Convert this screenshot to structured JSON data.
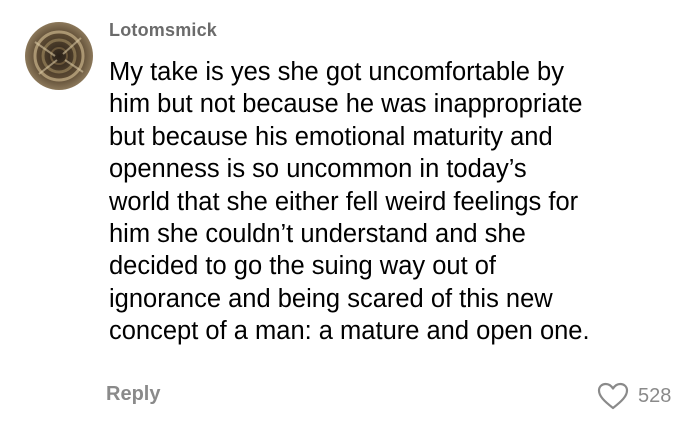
{
  "comment": {
    "username": "Lotomsmick",
    "avatar_icon": "avatar-photo-spiral-staircase",
    "lines": [
      "My take is yes she got uncomfortable by",
      "him but not because he was inappropriate",
      "but because his emotional maturity and",
      "openness is so uncommon in today’s",
      "world that she either fell weird feelings for",
      "him she couldn’t understand and she",
      "decided to go the suing way out of",
      "ignorance and being scared of this new",
      "concept of a man: a mature and open one."
    ],
    "reply_label": "Reply",
    "like_icon": "heart-outline-icon",
    "like_count": "528"
  },
  "colors": {
    "username": "#6b6b6b",
    "text": "#000000",
    "muted": "#8a8a8a",
    "background": "#ffffff"
  }
}
